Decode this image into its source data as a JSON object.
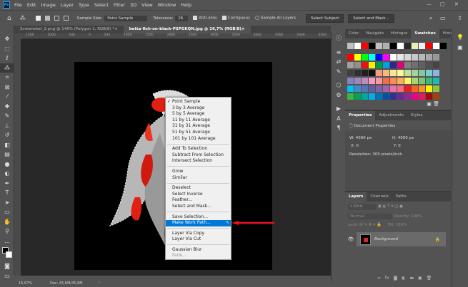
{
  "menubar": {
    "logo": "Ps",
    "items": [
      "File",
      "Edit",
      "Image",
      "Layer",
      "Type",
      "Select",
      "Filter",
      "3D",
      "View",
      "Window",
      "Help"
    ],
    "window_controls": [
      "—",
      "□",
      "✕"
    ]
  },
  "options": {
    "sample_size_label": "Sample Size:",
    "sample_size_value": "Point Sample",
    "tolerance_label": "Tolerance:",
    "tolerance_value": "26",
    "anti_alias": "Anti-alias",
    "contiguous": "Contiguous",
    "sample_all_layers": "Sample All Layers",
    "select_subject": "Select Subject",
    "select_and_mask": "Select and Mask..."
  },
  "tabs": [
    {
      "label": "Screenshot_2.png @ 146% (Polygon 1, RGB/8) *",
      "close": "×"
    },
    {
      "label": "betta-fish-on-black-PSPGKQN.jpg @ 16,7% (RGB/8)",
      "close": "×",
      "active": true
    }
  ],
  "ruler": [
    "1500",
    "1000",
    "500",
    "0",
    "500",
    "1000",
    "1500",
    "2000",
    "2500",
    "3000",
    "3500",
    "4000",
    "4500",
    "5000",
    "5500"
  ],
  "status": {
    "zoom": "16,67%",
    "doc": "Doc: 45,8M/45,8M"
  },
  "context_menu": {
    "groups": [
      [
        {
          "label": "Point Sample",
          "checked": true
        },
        {
          "label": "3 by 3 Average"
        },
        {
          "label": "5 by 5 Average"
        },
        {
          "label": "11 by 11 Average"
        },
        {
          "label": "31 by 31 Average"
        },
        {
          "label": "51 by 51 Average"
        },
        {
          "label": "101 by 101 Average"
        }
      ],
      [
        {
          "label": "Add To Selection"
        },
        {
          "label": "Subtract From Selection"
        },
        {
          "label": "Intersect Selection"
        }
      ],
      [
        {
          "label": "Grow"
        },
        {
          "label": "Similar"
        }
      ],
      [
        {
          "label": "Deselect"
        },
        {
          "label": "Select Inverse"
        },
        {
          "label": "Feather..."
        },
        {
          "label": "Select and Mask..."
        }
      ],
      [
        {
          "label": "Save Selection..."
        },
        {
          "label": "Make Work Path...",
          "highlighted": true
        }
      ],
      [
        {
          "label": "Layer Via Copy"
        },
        {
          "label": "Layer Via Cut"
        }
      ],
      [
        {
          "label": "Gaussian Blur"
        },
        {
          "label": "Fade...",
          "disabled": true
        }
      ]
    ]
  },
  "swatches_panel": {
    "tabs": [
      "Color",
      "Navigato",
      "Histogra",
      "Swatches",
      "History"
    ],
    "active": "Swatches",
    "recent": [
      "#c0c0c0",
      "#ffffff",
      "#ff0000",
      "#000000",
      "#c0c0c0",
      "#b0b0b0",
      "#000000",
      "#ffffff",
      "#2a2a2a",
      "#e8f0b8",
      "#f0f0f0",
      "#ff0000",
      "#ffffff",
      "#000000"
    ],
    "grid": [
      [
        "#ff0000",
        "#ffff00",
        "#00ff00",
        "#00ffff",
        "#0000ff",
        "#ff00ff",
        "#ffffff",
        "#e8e8e8",
        "#d8d8d8",
        "#c8c8c8",
        "#b8b8b8",
        "#a8a8a8",
        "#989898"
      ],
      [
        "#a0a0a0",
        "#909090",
        "#ee1111",
        "#ffee00",
        "#009944",
        "#00a0e0",
        "#2a2a8a",
        "#e0007a",
        "#808080",
        "#707070",
        "#606060",
        "#505050",
        "#454545"
      ],
      [
        "#404040",
        "#303030",
        "#202020",
        "#101010",
        "#f29c7f",
        "#f7b980",
        "#fde29a",
        "#fff79a",
        "#c4df9b",
        "#a3d39c",
        "#82ca9c",
        "#7accc8",
        "#8fb2de"
      ],
      [
        "#8781bd",
        "#a186be",
        "#bc8cbf",
        "#f49ac1",
        "#f5989d",
        "#f26c4f",
        "#f68e55",
        "#fbaf5c",
        "#fff467",
        "#acd372",
        "#7cc576",
        "#3bb878",
        "#1abbb4"
      ],
      [
        "#00bff3",
        "#438ccb",
        "#5574b9",
        "#605ca8",
        "#855fa8",
        "#a763a8",
        "#f06ea9",
        "#f26d7d",
        "#ed1c24",
        "#f26522",
        "#f7941d",
        "#fff200",
        "#8dc63f"
      ],
      [
        "#39b54a",
        "#00a651",
        "#00a99d",
        "#00aeef",
        "#0072bc",
        "#0054a6",
        "#2e3192",
        "#662d91",
        "#92278f",
        "#ec008c",
        "#ed145b",
        "#9e0b0f",
        "#a0410d"
      ]
    ]
  },
  "properties_panel": {
    "tabs": [
      "Properties",
      "Adjustments",
      "Styles"
    ],
    "title": "Document Properties",
    "w_label": "W:",
    "w": "4000 px",
    "h_label": "H:",
    "h": "4000 px",
    "x_label": "X:",
    "x": "0",
    "y_label": "Y:",
    "y": "0",
    "resolution": "Resolution: 300 pixels/inch"
  },
  "layers_panel": {
    "tabs": [
      "Layers",
      "Channels",
      "Paths"
    ],
    "filter": "Kind",
    "blend": "Normal",
    "opacity_label": "Opacity:",
    "opacity": "100%",
    "lock_label": "Lock:",
    "fill_label": "Fill:",
    "fill": "100%",
    "layers": [
      {
        "name": "Background",
        "visible": true,
        "locked": true
      }
    ],
    "bottom_icons": [
      "link",
      "fx",
      "mask",
      "adjustment",
      "folder",
      "new-layer",
      "trash"
    ]
  }
}
